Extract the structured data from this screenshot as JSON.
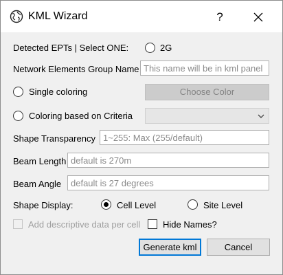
{
  "window": {
    "title": "KML Wizard",
    "help_label": "?"
  },
  "detected": {
    "label": "Detected EPTs | Select ONE:",
    "option_label": "2G"
  },
  "group_name": {
    "label": "Network Elements Group Name",
    "placeholder": "This name will be in kml panel"
  },
  "coloring": {
    "single_label": "Single coloring",
    "choose_color_label": "Choose Color",
    "criteria_label": "Coloring based on Criteria",
    "criteria_selected": ""
  },
  "transparency": {
    "label": "Shape Transparency",
    "placeholder": "1~255: Max (255/default)"
  },
  "beam_length": {
    "label": "Beam Length",
    "placeholder": "default is 270m"
  },
  "beam_angle": {
    "label": "Beam Angle",
    "placeholder": "default is 27 degrees"
  },
  "shape_display": {
    "label": "Shape Display:",
    "cell_level_label": "Cell Level",
    "site_level_label": "Site Level",
    "selected": "Cell Level"
  },
  "options": {
    "descriptive_label": "Add descriptive data per cell",
    "hide_names_label": "Hide Names?"
  },
  "actions": {
    "generate_label": "Generate kml",
    "cancel_label": "Cancel"
  },
  "colors": {
    "accent": "#0078d7",
    "window_bg": "#f0f0f0",
    "disabled_button": "#cccccc"
  }
}
